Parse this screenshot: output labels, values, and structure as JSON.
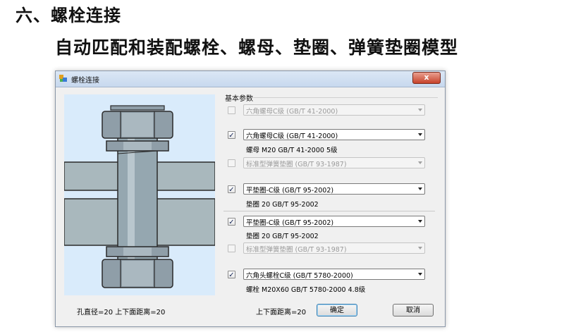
{
  "heading": "六、螺栓连接",
  "subheading": "自动匹配和装配螺栓、螺母、垫圈、弹簧垫圈模型",
  "dialog": {
    "title": "螺栓连接",
    "close_label": "x",
    "group_label": "基本参数",
    "rows": [
      {
        "checked": false,
        "enabled": false,
        "select_value": "六角螺母C级 (GB/T 41-2000)",
        "description": ""
      },
      {
        "checked": true,
        "enabled": true,
        "select_value": "六角螺母C级 (GB/T 41-2000)",
        "description": "螺母  M20   GB/T 41-2000   5级"
      },
      {
        "checked": false,
        "enabled": false,
        "select_value": "标准型弹簧垫圈 (GB/T 93-1987)",
        "description": ""
      },
      {
        "checked": true,
        "enabled": true,
        "select_value": "平垫圈-C级 (GB/T 95-2002)",
        "description": "垫圈  20   GB/T 95-2002"
      },
      {
        "checked": true,
        "enabled": true,
        "select_value": "平垫圈-C级 (GB/T 95-2002)",
        "description": "垫圈  20   GB/T 95-2002"
      },
      {
        "checked": false,
        "enabled": false,
        "select_value": "标准型弹簧垫圈 (GB/T 93-1987)",
        "description": ""
      },
      {
        "checked": true,
        "enabled": true,
        "select_value": "六角头螺栓C级 (GB/T 5780-2000)",
        "description": "螺栓  M20X60   GB/T 5780-2000   4.8级"
      }
    ],
    "status_left": "孔直径=20  上下面距离=20",
    "status_right": "上下面距离=20",
    "ok_label": "确定",
    "cancel_label": "取消",
    "check_mark": "✓"
  },
  "colors": {
    "canvas_bg": "#d9ebfb",
    "plate": "#a9b8bd",
    "bolt": "#95a7b0",
    "nut": "#8f9ea8"
  }
}
